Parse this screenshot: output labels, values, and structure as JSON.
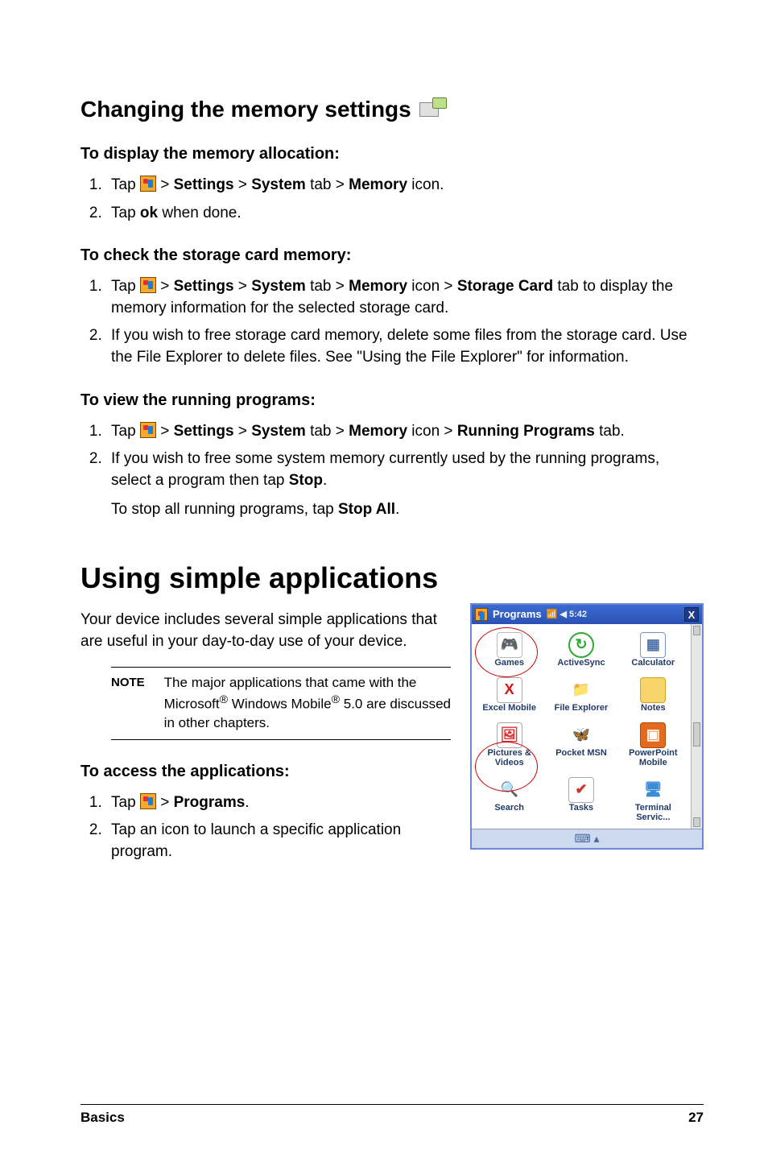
{
  "headings": {
    "h2_memory": "Changing the memory settings",
    "h3_alloc": "To display the memory allocation:",
    "h3_storage": "To check the storage card memory:",
    "h3_running": "To view the running programs:",
    "h1_simple": "Using simple applications",
    "h3_access": "To access the applications:"
  },
  "alloc_steps": {
    "s1a": "Tap ",
    "s1b": " > ",
    "s1_settings": "Settings",
    "s1c": " > ",
    "s1_system": "System",
    "s1d": " tab >  ",
    "s1_memory": "Memory",
    "s1e": " icon.",
    "s2a": "Tap ",
    "s2_ok": "ok",
    "s2b": " when done."
  },
  "storage_steps": {
    "s1a": "Tap ",
    "gt1": " > ",
    "settings": "Settings",
    "gt2": " > ",
    "system": "System",
    "tab_gt": " tab > ",
    "memory": "Memory",
    "icon_gt": " icon > ",
    "storage_card": "Storage Card",
    "tab_end": " tab to display the memory information for the selected storage card.",
    "s2": "If you wish to free storage card memory, delete some files from the storage card. Use the File Explorer to delete files. See \"Using the File Explorer\" for information."
  },
  "running_steps": {
    "s1a": "Tap ",
    "gt1": " > ",
    "settings": "Settings",
    "gt2": " > ",
    "system": "System",
    "tab_gt": " tab > ",
    "memory": "Memory",
    "icon_gt": " icon > ",
    "running": "Running Programs",
    "tab_end": " tab.",
    "s2a": "If you wish to free some system memory currently used by the running programs, select a program then tap ",
    "stop": "Stop",
    "s2b": ".",
    "s3a": "To stop all running programs, tap ",
    "stopall": "Stop All",
    "s3b": "."
  },
  "simple_intro": "Your device includes several simple applications that are useful in your day-to-day use of your device.",
  "note": {
    "label": "NOTE",
    "text_a": "The major applications that came with the Microsoft",
    "reg": "®",
    "text_b": " Windows Mobile",
    "reg2": "®",
    "text_c": " 5.0 are discussed in other chapters."
  },
  "access_steps": {
    "s1a": "Tap ",
    "gt1": " > ",
    "programs": "Programs",
    "s1b": ".",
    "s2": "Tap an icon to launch a specific application program."
  },
  "device": {
    "title": "Programs",
    "status": "5:42",
    "close": "X",
    "apps": {
      "games": "Games",
      "activesync": "ActiveSync",
      "calculator": "Calculator",
      "excel": "Excel Mobile",
      "file_explorer": "File Explorer",
      "notes": "Notes",
      "pictures": "Pictures & Videos",
      "pocket_msn": "Pocket MSN",
      "powerpoint": "PowerPoint Mobile",
      "search": "Search",
      "tasks": "Tasks",
      "terminal": "Terminal Servic..."
    }
  },
  "footer": {
    "section": "Basics",
    "page": "27"
  }
}
